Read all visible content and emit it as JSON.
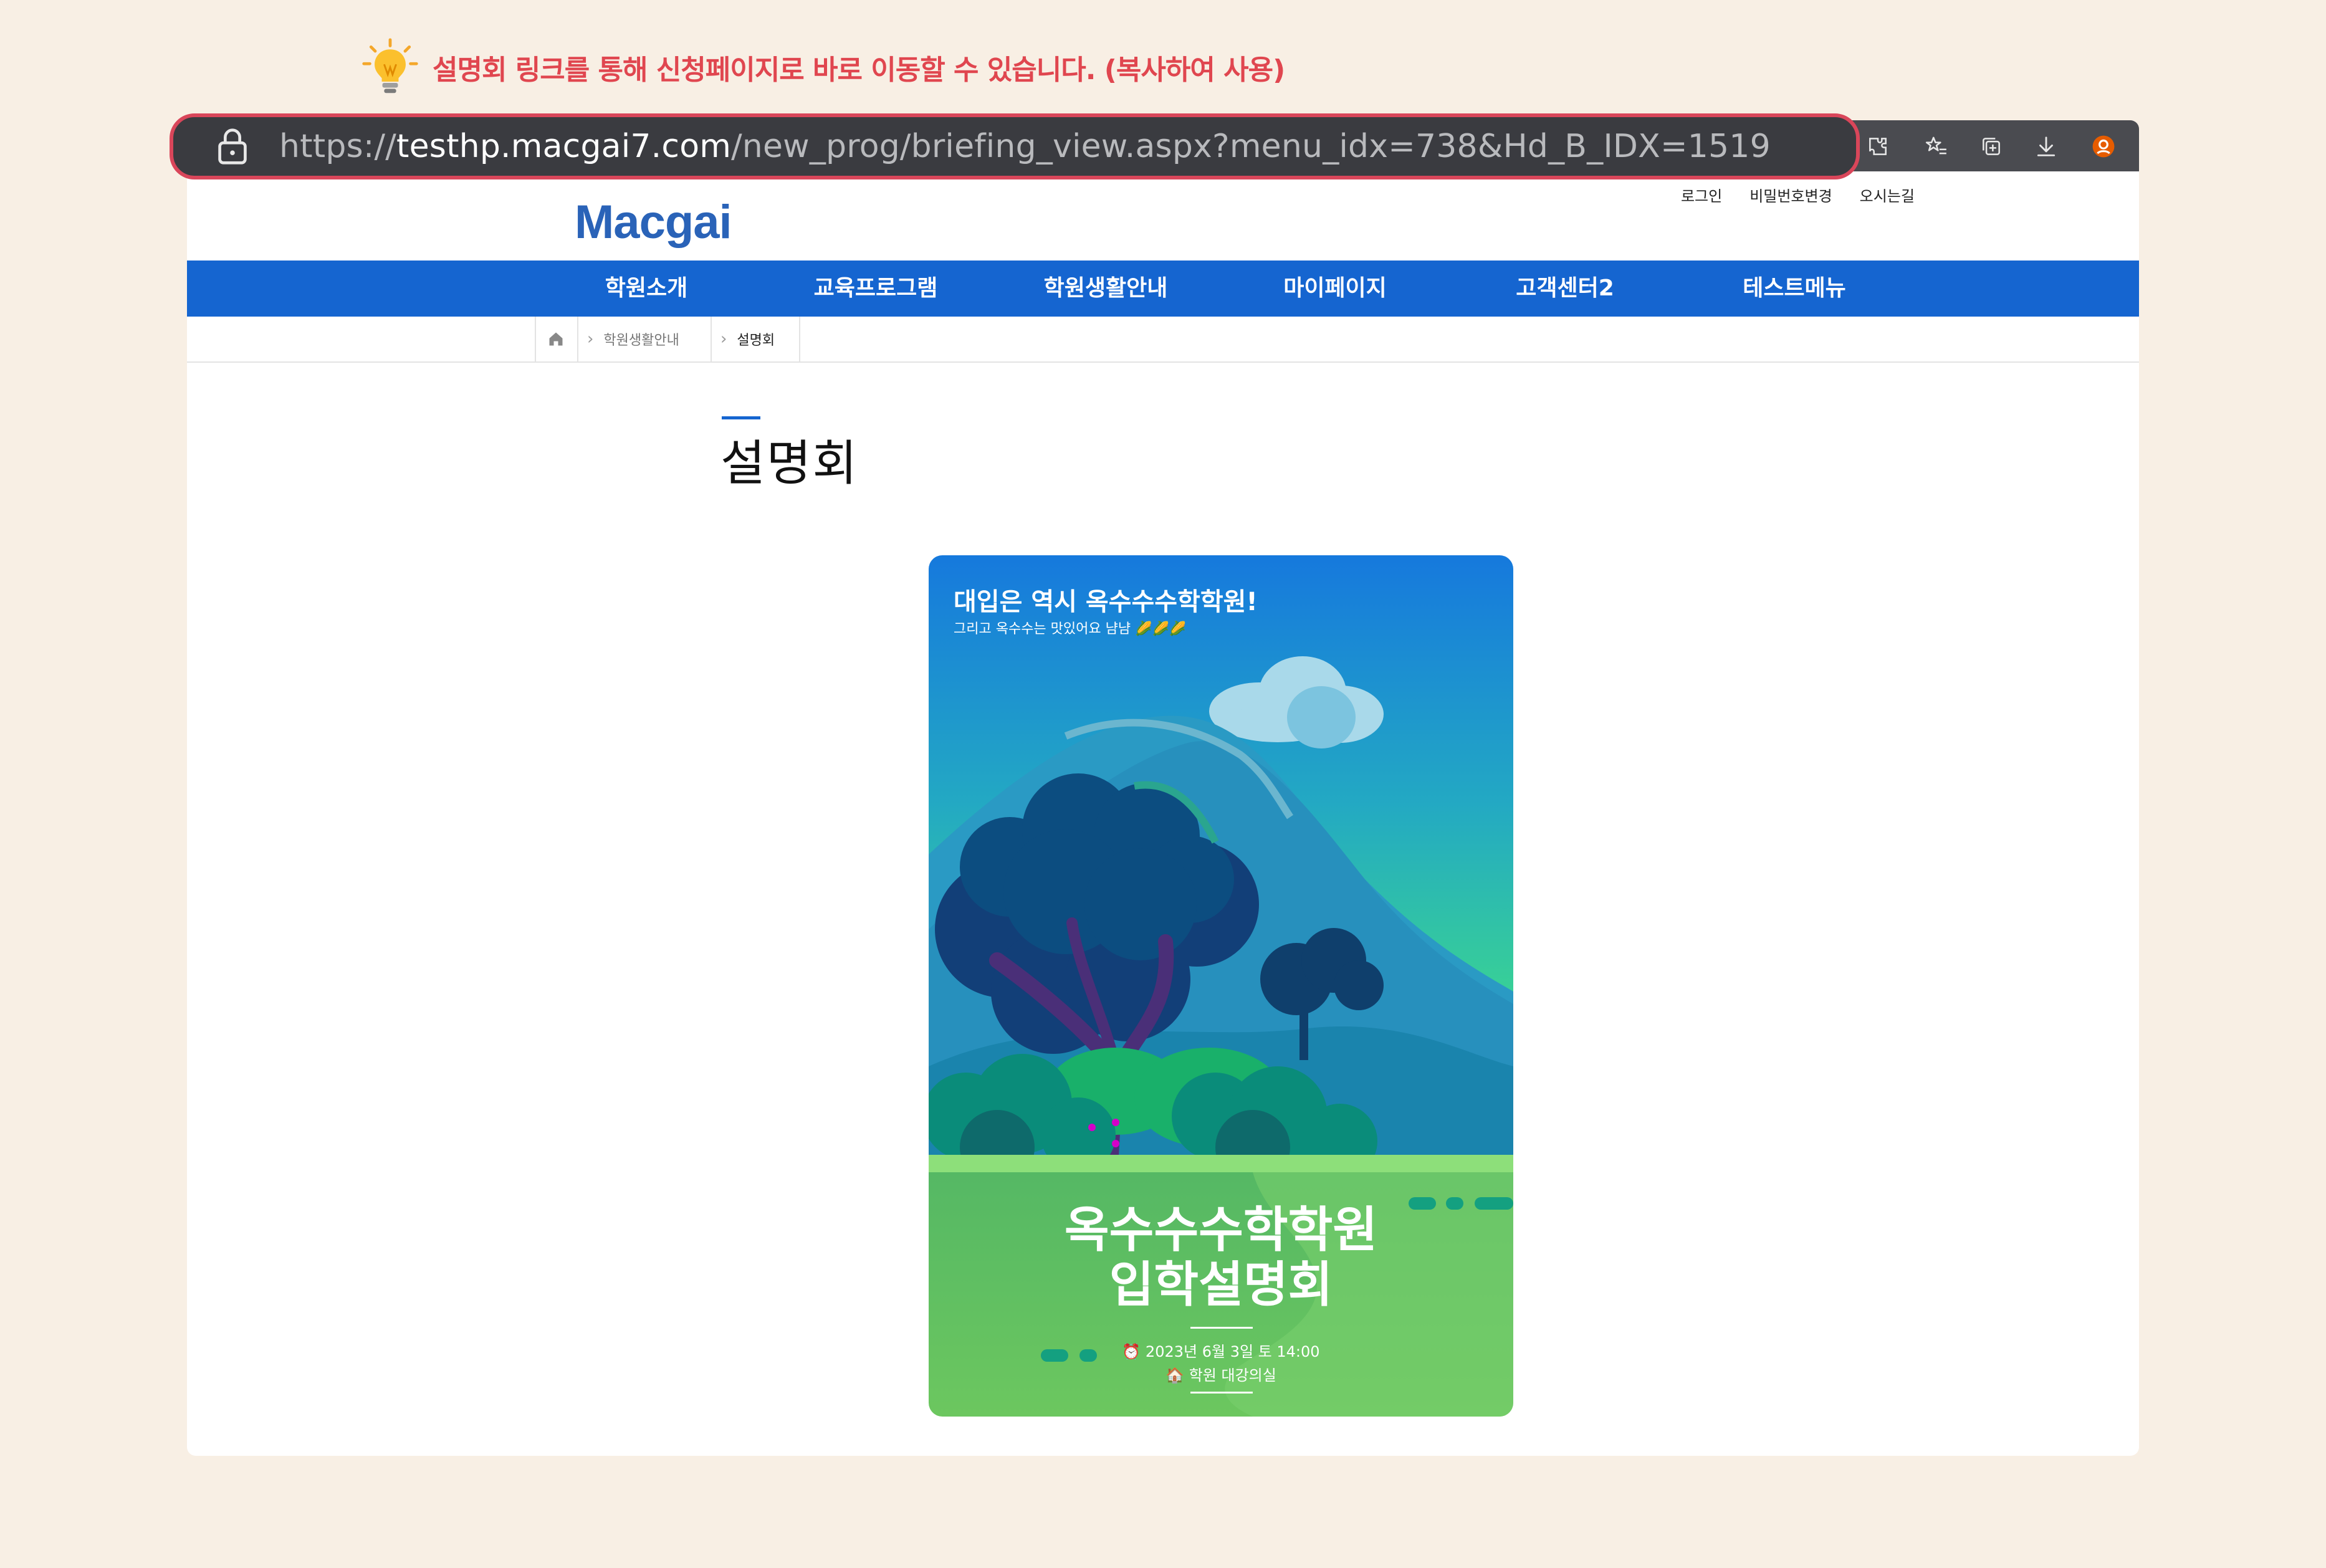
{
  "tip": {
    "icon": "lightbulb-icon",
    "text": "설명회 링크를 통해 신청페이지로 바로 이동할 수 있습니다. (복사하여 사용)",
    "color": "#e0464f"
  },
  "browser": {
    "url_scheme": "https://",
    "url_domain": "testhp.macgai7.com",
    "url_path": "/new_prog/briefing_view.aspx?menu_idx=738&Hd_B_IDX=1519",
    "highlight_color": "#d9465a"
  },
  "site": {
    "logo": "Macgai",
    "top_links": [
      "로그인",
      "비밀번호변경",
      "오시는길"
    ],
    "nav": [
      "학원소개",
      "교육프로그램",
      "학원생활안내",
      "마이페이지",
      "고객센터2",
      "테스트메뉴"
    ],
    "nav_color": "#1565d0",
    "breadcrumb": [
      "학원생활안내",
      "설명회"
    ],
    "page_title": "설명회"
  },
  "poster": {
    "headline": "대입은 역시 옥수수수학학원!",
    "subline": "그리고 옥수수는 맛있어요 냠냠 🌽🌽🌽",
    "title_line1": "옥수수수학학원",
    "title_line2": "입학설명회",
    "date": "⏰ 2023년 6월 3일 토 14:00",
    "place": "🏠 학원 대강의실"
  }
}
